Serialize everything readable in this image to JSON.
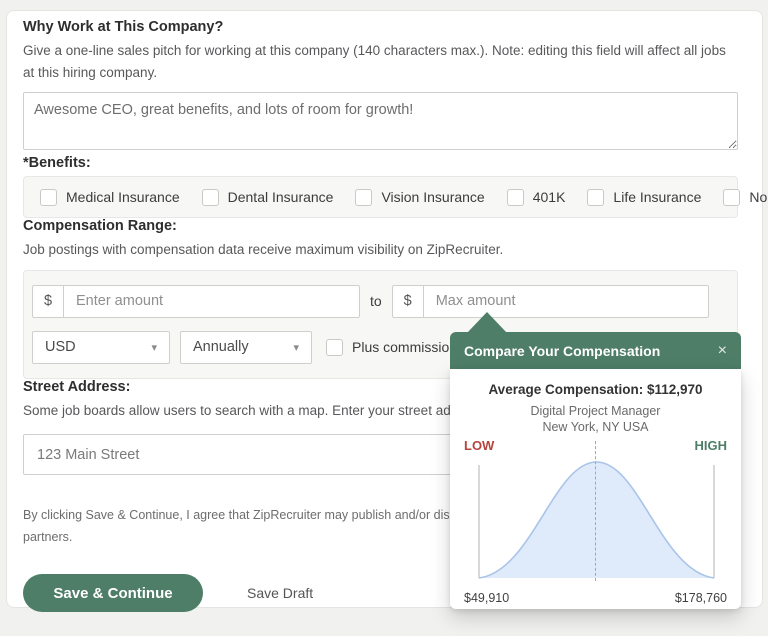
{
  "why_section": {
    "title": "Why Work at This Company?",
    "description": "Give a one-line sales pitch for working at this company (140 characters max.). Note: editing this field will affect all jobs at this hiring company.",
    "pitch_value": "Awesome CEO, great benefits, and lots of room for growth!"
  },
  "benefits": {
    "title": "*Benefits:",
    "options": [
      "Medical Insurance",
      "Dental Insurance",
      "Vision Insurance",
      "401K",
      "Life Insurance",
      "None of These"
    ]
  },
  "compensation": {
    "title": "Compensation Range:",
    "description": "Job postings with compensation data receive maximum visibility on ZipRecruiter.",
    "currency_symbol": "$",
    "min_placeholder": "Enter amount",
    "to_label": "to",
    "max_placeholder": "Max amount",
    "currency_value": "USD",
    "interval_value": "Annually",
    "chevron": "▾",
    "plus_commission_label": "Plus commission"
  },
  "street_address": {
    "title": "Street Address:",
    "description": "Some job boards allow users to search with a map. Enter your street address for be",
    "value": "123 Main Street"
  },
  "legal": {
    "line1": "By clicking Save & Continue, I agree that ZipRecruiter may publish and/or distribute my jo",
    "line2": "partners."
  },
  "actions": {
    "save_continue": "Save & Continue",
    "save_draft": "Save Draft"
  },
  "popup": {
    "title": "Compare Your Compensation",
    "close": "×",
    "average_line": "Average Compensation: $112,970",
    "job_title": "Digital Project Manager",
    "location": "New York, NY USA",
    "low_label": "LOW",
    "high_label": "HIGH",
    "min_value": "$49,910",
    "max_value": "$178,760"
  },
  "colors": {
    "brand_green": "#4e7d68",
    "low_red": "#b5443e",
    "curve_fill": "#dfeafa",
    "curve_stroke": "#a9c4e8",
    "page_bg": "#f1f1ef"
  },
  "chart_data": {
    "type": "area",
    "description": "Normal (bell-curve) compensation distribution with dashed vertical marker at the average",
    "title": "Average Compensation: $112,970",
    "subtitle": "Digital Project Manager, New York, NY USA",
    "x_min": 49910,
    "x_max": 178760,
    "average": 112970,
    "x_tick_labels": [
      "$49,910",
      "$178,760"
    ],
    "end_annotations": [
      "LOW",
      "HIGH"
    ],
    "grid": false,
    "legend": false
  }
}
